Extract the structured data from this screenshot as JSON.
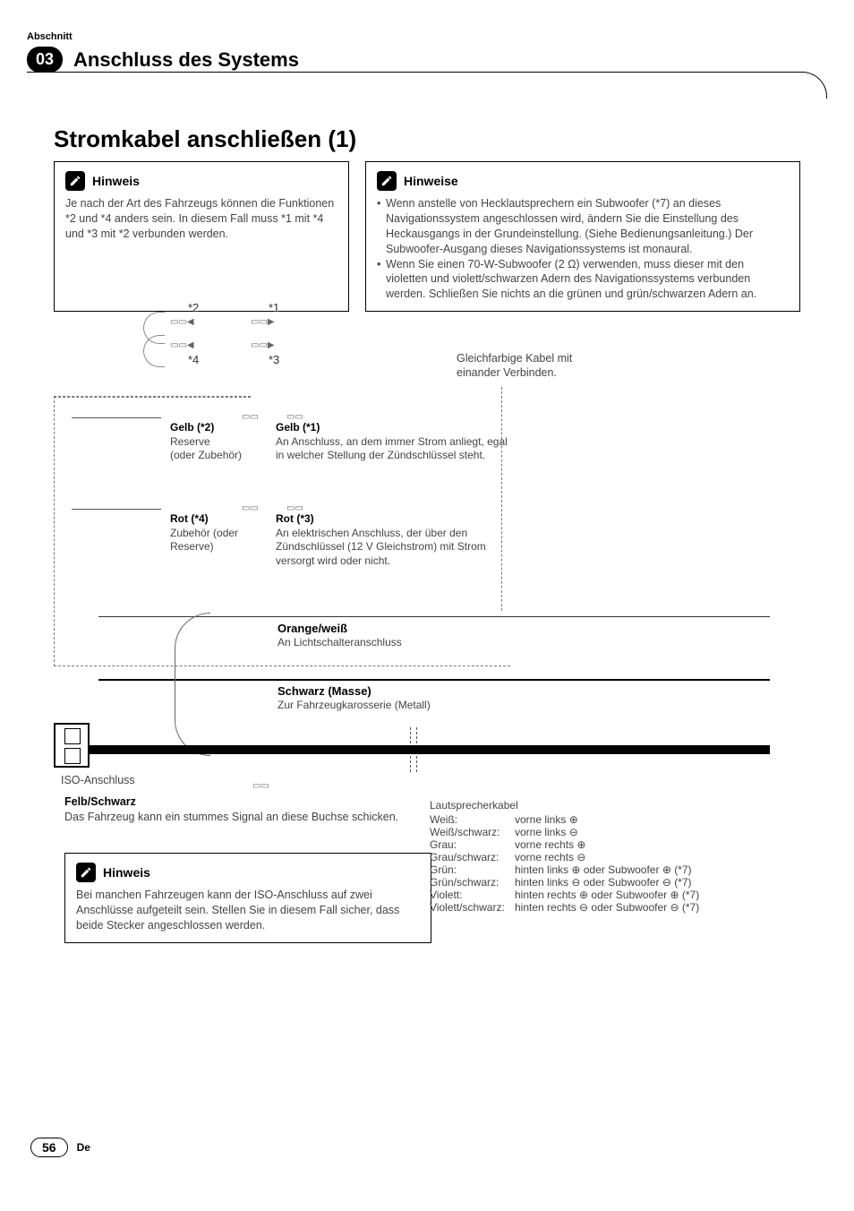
{
  "section_label": "Abschnitt",
  "section_number": "03",
  "section_title": "Anschluss des Systems",
  "main_title": "Stromkabel anschließen (1)",
  "note1": {
    "title": "Hinweis",
    "body": "Je nach der Art des Fahrzeugs können die Funktionen *2 und *4 anders sein. In diesem Fall muss *1 mit *4 und *3 mit *2 verbunden werden."
  },
  "note2": {
    "title": "Hinweise",
    "items": [
      "Wenn anstelle von Hecklautsprechern ein Subwoofer (*7) an dieses Navigationssystem angeschlossen wird, ändern Sie die Einstellung des Heckausgangs in der Grundeinstellung. (Siehe Bedienungsanleitung.) Der Subwoofer-Ausgang dieses Navigationssystems ist monaural.",
      "Wenn Sie einen 70-W-Subwoofer (2 Ω) verwenden, muss dieser mit den violetten und violett/schwarzen Adern des Navigationssystems verbunden werden. Schließen Sie nichts an die grünen und grün/schwarzen Adern an."
    ]
  },
  "refs": {
    "r1": "*1",
    "r2": "*2",
    "r3": "*3",
    "r4": "*4"
  },
  "match_label": "Gleichfarbige Kabel mit einander Verbinden.",
  "gelb2": {
    "title": "Gelb (*2)",
    "l1": "Reserve",
    "l2": "(oder Zubehör)"
  },
  "gelb1": {
    "title": "Gelb (*1)",
    "l1": "An Anschluss, an dem immer Strom anliegt, egal in welcher Stellung der Zündschlüssel steht."
  },
  "rot4": {
    "title": "Rot (*4)",
    "l1": "Zubehör (oder Reserve)"
  },
  "rot3": {
    "title": "Rot (*3)",
    "l1": "An elektrischen Anschluss, der über den Zündschlüssel (12 V Gleichstrom) mit Strom versorgt wird oder nicht."
  },
  "orange": {
    "title": "Orange/weiß",
    "l1": "An Lichtschalteranschluss"
  },
  "schwarz": {
    "title": "Schwarz (Masse)",
    "l1": "Zur Fahrzeugkarosserie (Metall)"
  },
  "iso_label": "ISO-Anschluss",
  "gelb_schwarz": {
    "title": "Felb/Schwarz",
    "body": "Das Fahrzeug kann ein stummes Signal an diese Buchse schicken."
  },
  "note3": {
    "title": "Hinweis",
    "body": "Bei manchen Fahrzeugen kann der ISO-Anschluss auf zwei Anschlüsse aufgeteilt sein. Stellen Sie in diesem Fall sicher, dass beide Stecker angeschlossen werden."
  },
  "speakers": {
    "header": "Lautsprecherkabel",
    "rows": [
      {
        "c": "Weiß:",
        "d": "vorne links ⊕"
      },
      {
        "c": "Weiß/schwarz:",
        "d": "vorne links ⊖"
      },
      {
        "c": "Grau:",
        "d": "vorne rechts ⊕"
      },
      {
        "c": "Grau/schwarz:",
        "d": "vorne rechts ⊖"
      },
      {
        "c": "Grün:",
        "d": "hinten links ⊕ oder Subwoofer ⊕ (*7)"
      },
      {
        "c": "Grün/schwarz:",
        "d": "hinten links ⊖ oder Subwoofer ⊖ (*7)"
      },
      {
        "c": "Violett:",
        "d": "hinten rechts ⊕ oder Subwoofer ⊕ (*7)"
      },
      {
        "c": "Violett/schwarz:",
        "d": "hinten rechts ⊖ oder Subwoofer ⊖ (*7)"
      }
    ]
  },
  "page_number": "56",
  "lang": "De"
}
